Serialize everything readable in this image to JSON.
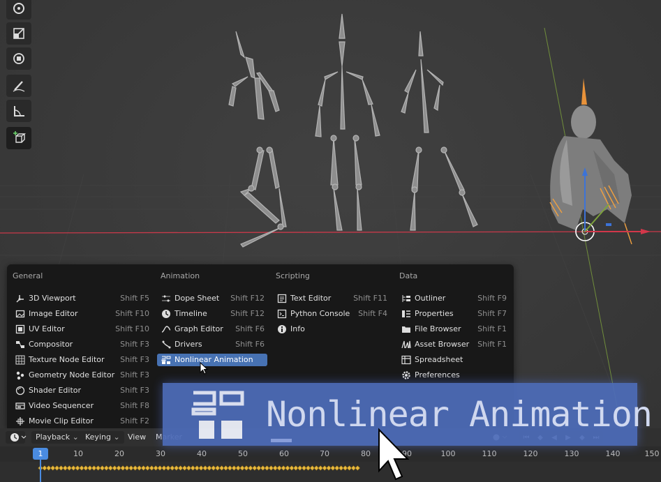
{
  "viewport": {
    "tools": [
      "rotate-icon",
      "scale-icon",
      "transform-icon",
      "annotate-icon",
      "measure-icon",
      "add-cube-icon"
    ]
  },
  "menu": {
    "columns": [
      {
        "heading": "General",
        "items": [
          {
            "label": "3D Viewport",
            "shortcut": "Shift F5",
            "icon": "viewport-3d-icon"
          },
          {
            "label": "Image Editor",
            "shortcut": "Shift F10",
            "icon": "image-editor-icon"
          },
          {
            "label": "UV Editor",
            "shortcut": "Shift F10",
            "icon": "uv-editor-icon"
          },
          {
            "label": "Compositor",
            "shortcut": "Shift F3",
            "icon": "compositor-icon"
          },
          {
            "label": "Texture Node Editor",
            "shortcut": "Shift F3",
            "icon": "texture-node-icon"
          },
          {
            "label": "Geometry Node Editor",
            "shortcut": "Shift F3",
            "icon": "geometry-node-icon"
          },
          {
            "label": "Shader Editor",
            "shortcut": "Shift F3",
            "icon": "shader-editor-icon"
          },
          {
            "label": "Video Sequencer",
            "shortcut": "Shift F8",
            "icon": "video-sequencer-icon"
          },
          {
            "label": "Movie Clip Editor",
            "shortcut": "Shift F2",
            "icon": "movie-clip-icon"
          }
        ]
      },
      {
        "heading": "Animation",
        "items": [
          {
            "label": "Dope Sheet",
            "shortcut": "Shift F12",
            "icon": "dope-sheet-icon"
          },
          {
            "label": "Timeline",
            "shortcut": "Shift F12",
            "icon": "timeline-icon"
          },
          {
            "label": "Graph Editor",
            "shortcut": "Shift F6",
            "icon": "graph-editor-icon"
          },
          {
            "label": "Drivers",
            "shortcut": "Shift F6",
            "icon": "drivers-icon"
          },
          {
            "label": "Nonlinear Animation",
            "shortcut": "",
            "icon": "nla-icon",
            "highlighted": true
          }
        ]
      },
      {
        "heading": "Scripting",
        "items": [
          {
            "label": "Text Editor",
            "shortcut": "Shift F11",
            "icon": "text-editor-icon"
          },
          {
            "label": "Python Console",
            "shortcut": "Shift F4",
            "icon": "python-console-icon"
          },
          {
            "label": "Info",
            "shortcut": "",
            "icon": "info-icon"
          }
        ]
      },
      {
        "heading": "Data",
        "items": [
          {
            "label": "Outliner",
            "shortcut": "Shift F9",
            "icon": "outliner-icon"
          },
          {
            "label": "Properties",
            "shortcut": "Shift F7",
            "icon": "properties-icon"
          },
          {
            "label": "File Browser",
            "shortcut": "Shift F1",
            "icon": "file-browser-icon"
          },
          {
            "label": "Asset Browser",
            "shortcut": "Shift F1",
            "icon": "asset-browser-icon"
          },
          {
            "label": "Spreadsheet",
            "shortcut": "",
            "icon": "spreadsheet-icon"
          },
          {
            "label": "Preferences",
            "shortcut": "",
            "icon": "preferences-icon"
          }
        ]
      }
    ]
  },
  "zoom_overlay": {
    "label": "Nonlinear Animation"
  },
  "timeline": {
    "menus": {
      "playback": "Playback",
      "keying": "Keying",
      "view": "View",
      "marker": "Marker"
    },
    "current_frame": "1",
    "frame_ticks": [
      "10",
      "20",
      "30",
      "40",
      "50",
      "60",
      "70",
      "80",
      "90",
      "100",
      "110",
      "120",
      "130",
      "140",
      "150"
    ],
    "accent_color": "#4a8be0",
    "keyframe_color": "#e8b93d"
  },
  "colors": {
    "highlight": "#4772b3",
    "menu_bg": "#181818",
    "x_axis": "#c9394a",
    "y_axis": "#7ea33c"
  }
}
